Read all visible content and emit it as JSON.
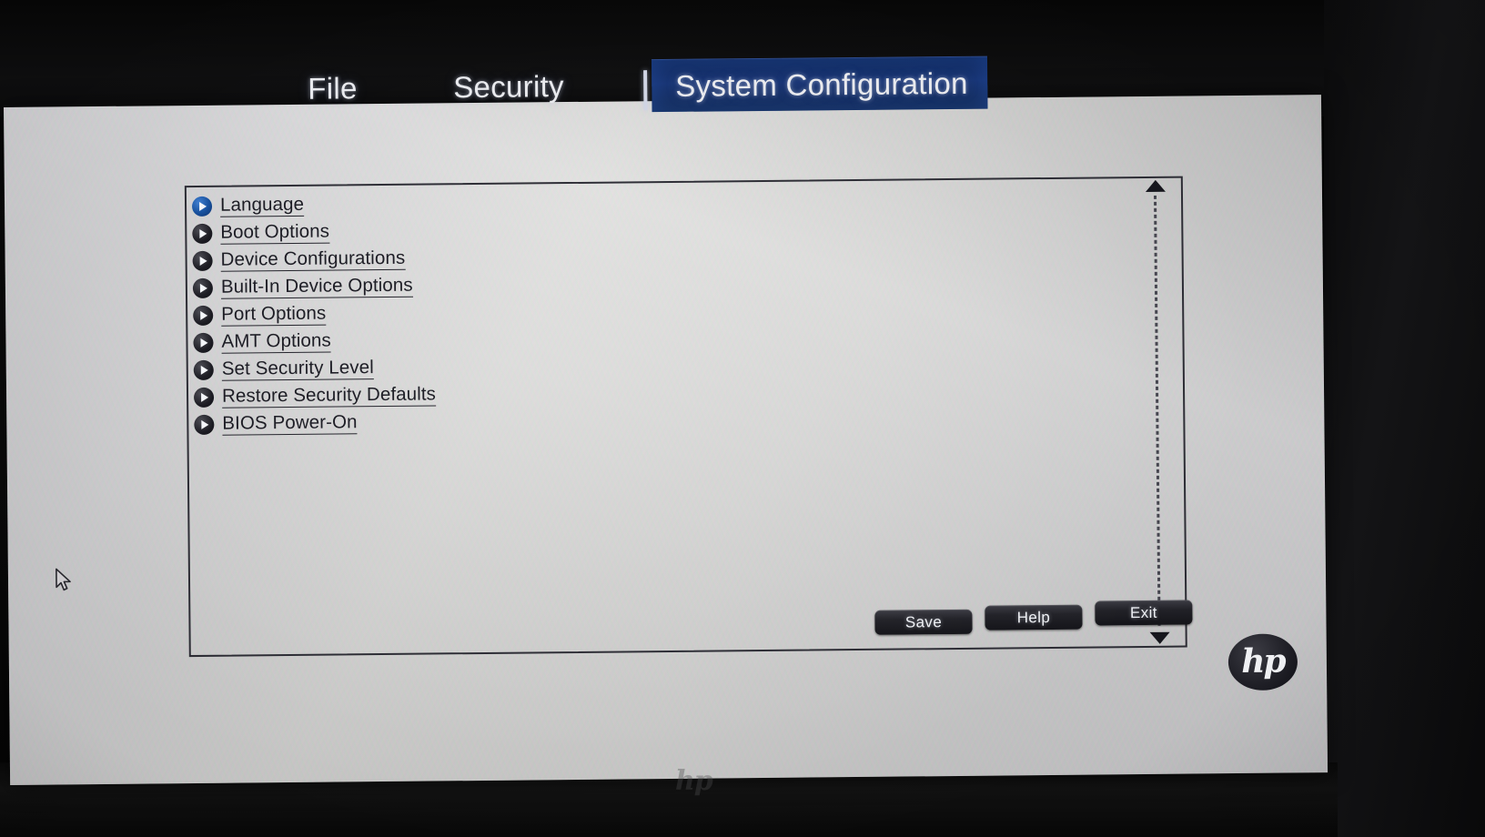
{
  "screen": {
    "brand": "hp",
    "bezel_brand": "hp"
  },
  "tabs": [
    {
      "label": "File",
      "active": false
    },
    {
      "label": "Security",
      "active": false
    },
    {
      "label": "System Configuration",
      "active": true
    }
  ],
  "menu": {
    "items": [
      {
        "label": "Language",
        "selected": true
      },
      {
        "label": "Boot Options",
        "selected": false
      },
      {
        "label": "Device Configurations",
        "selected": false
      },
      {
        "label": "Built-In Device Options",
        "selected": false
      },
      {
        "label": "Port Options",
        "selected": false
      },
      {
        "label": "AMT Options",
        "selected": false
      },
      {
        "label": "Set Security Level",
        "selected": false
      },
      {
        "label": "Restore Security Defaults",
        "selected": false
      },
      {
        "label": "BIOS Power-On",
        "selected": false
      }
    ]
  },
  "scrollbar": {
    "up_arrow": "scroll-up-arrow",
    "down_arrow": "scroll-down-arrow"
  },
  "buttons": [
    {
      "label": "Save"
    },
    {
      "label": "Help"
    },
    {
      "label": "Exit"
    }
  ],
  "colors": {
    "active_tab_bg": "#163271",
    "selected_bullet": "#17509e",
    "bullet": "#1b1b22",
    "panel_bg": "#d6d4d6",
    "text": "#1a1a22",
    "button_bg": "#212127"
  },
  "icons": {
    "cursor": "mouse-pointer-icon",
    "bullet": "play-triangle-icon",
    "logo": "hp-logo-icon"
  }
}
